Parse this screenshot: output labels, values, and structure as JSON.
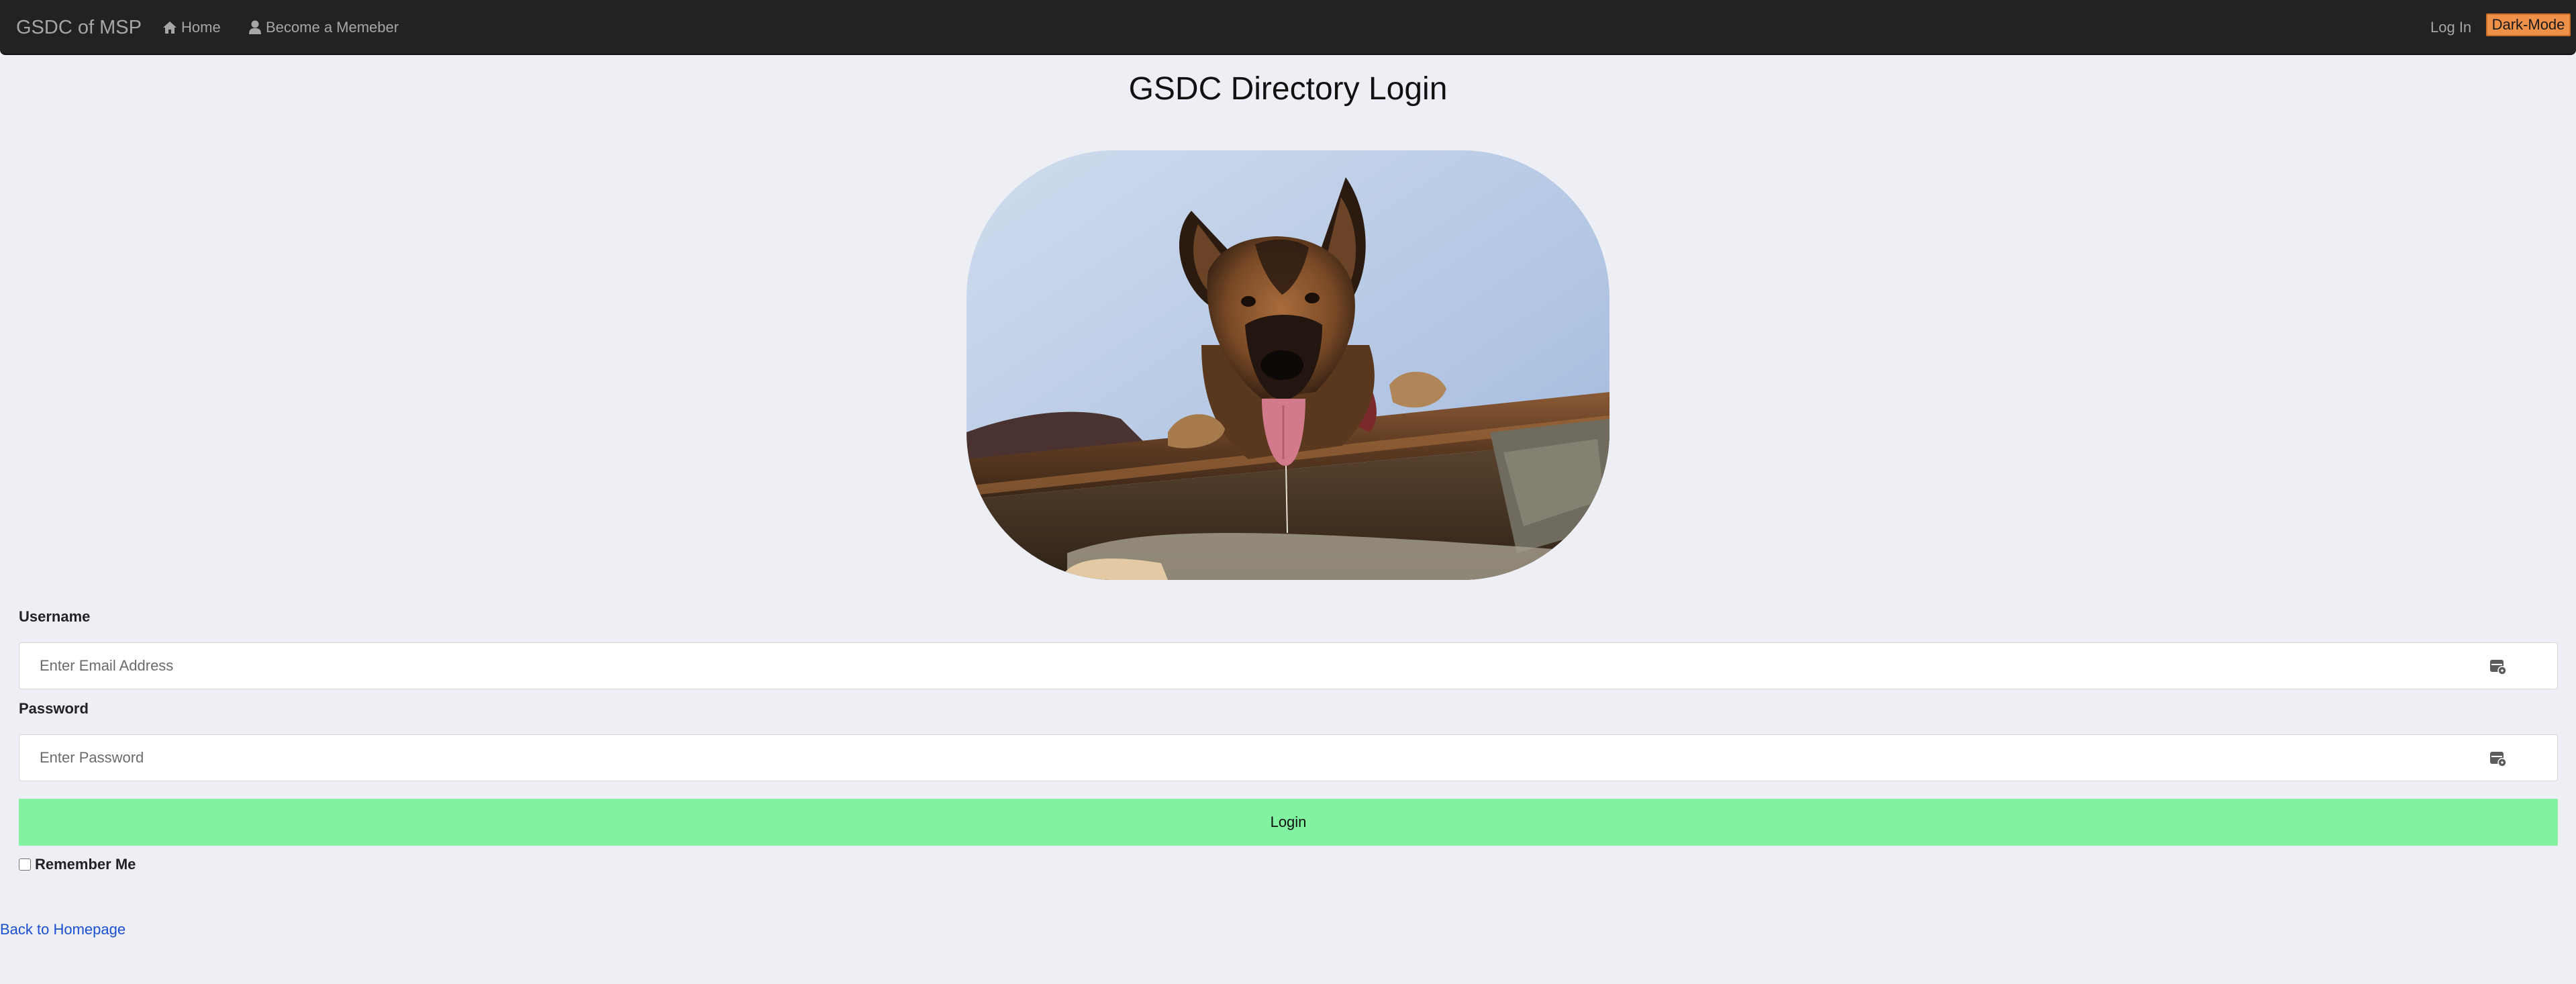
{
  "navbar": {
    "brand": "GSDC of MSP",
    "home_label": "Home",
    "member_label": "Become a Memeber",
    "login_label": "Log In",
    "dark_mode_label": "Dark-Mode",
    "dark_mode_color": "#f0914a"
  },
  "page": {
    "title": "GSDC Directory Login"
  },
  "form": {
    "username_label": "Username",
    "username_placeholder": "Enter Email Address",
    "username_value": "",
    "password_label": "Password",
    "password_placeholder": "Enter Password",
    "password_value": "",
    "login_button": "Login",
    "login_button_color": "#82f2a0",
    "remember_label": "Remember Me",
    "remember_checked": false
  },
  "footer": {
    "back_link": "Back to Homepage"
  },
  "icons": {
    "home": "home-icon",
    "member": "user-icon",
    "password_manager": "password-manager-icon"
  }
}
